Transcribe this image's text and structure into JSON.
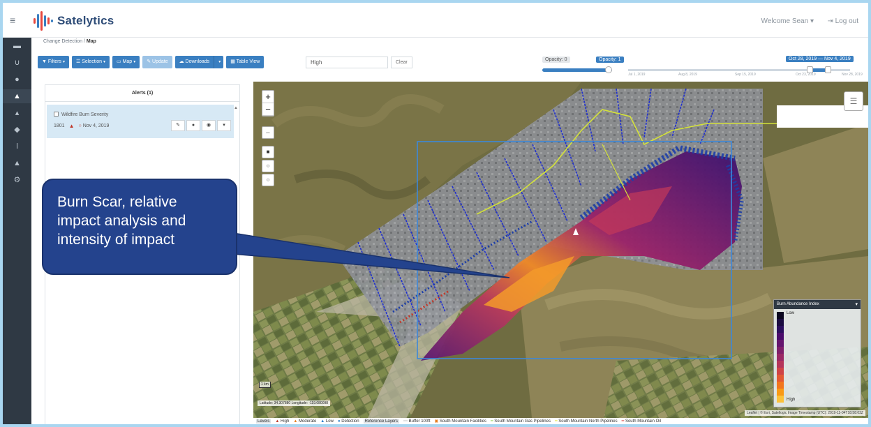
{
  "app": {
    "name": "Satelytics",
    "welcome": "Welcome Sean",
    "logout": "Log out"
  },
  "breadcrumb": {
    "parent": "Change Detection",
    "separator": "/",
    "current": "Map"
  },
  "toolbar": {
    "filters": "Filters",
    "selection": "Selection",
    "map": "Map",
    "update": "Update",
    "downloads": "Downloads",
    "table_view": "Table View",
    "search_value": "High",
    "clear": "Clear"
  },
  "sliders": {
    "opacity_label": "Opacity: 0",
    "opacity_badge": "Opacity: 1",
    "opacity_value": 1,
    "date_range": "Oct 28, 2019 — Nov 4, 2019",
    "timeline_ticks": [
      "Jul 1, 2019",
      "Aug 8, 2019",
      "Sep 15, 2019",
      "Oct 23, 2019",
      "Nov 28, 2019"
    ]
  },
  "alerts": {
    "title": "Alerts (1)",
    "items": [
      {
        "name": "Wildfire Burn Severity",
        "id": "1801",
        "date": "Nov 4, 2019"
      }
    ]
  },
  "legend": {
    "title": "Burn Abundance Index",
    "low": "Low",
    "high": "High",
    "colors": [
      "#0b0720",
      "#1b0c41",
      "#2c0f5e",
      "#4a0c6b",
      "#65156e",
      "#7f1f6a",
      "#9a2865",
      "#b5355a",
      "#cf4446",
      "#e35933",
      "#f2761e",
      "#f99a16",
      "#fbc13a"
    ]
  },
  "map": {
    "scale": "1 km",
    "coords": "Latitude: 34.307880  Longitude: -119.080098",
    "attribution": "Leaflet | © Esri, Satellogic  Image Timestamp (UTC): 2019-11-04T18:58:03Z"
  },
  "levels_bar": {
    "levels_label": "Levels",
    "high": "High",
    "moderate": "Moderate",
    "low": "Low",
    "detection": "Detection",
    "reference": "Reference Layers",
    "buffer": "Buffer 100ft",
    "facilities": "South Mountain Facilities",
    "gas": "South Mountain Gas Pipelines",
    "north": "South Mountain North Pipelines",
    "oil": "South Mountain Oil"
  },
  "callout": {
    "text": "Burn Scar, relative impact analysis and intensity of impact"
  },
  "colors": {
    "primary": "#3a7fc1",
    "sidebar": "#2f3944",
    "callout": "#24438d"
  }
}
